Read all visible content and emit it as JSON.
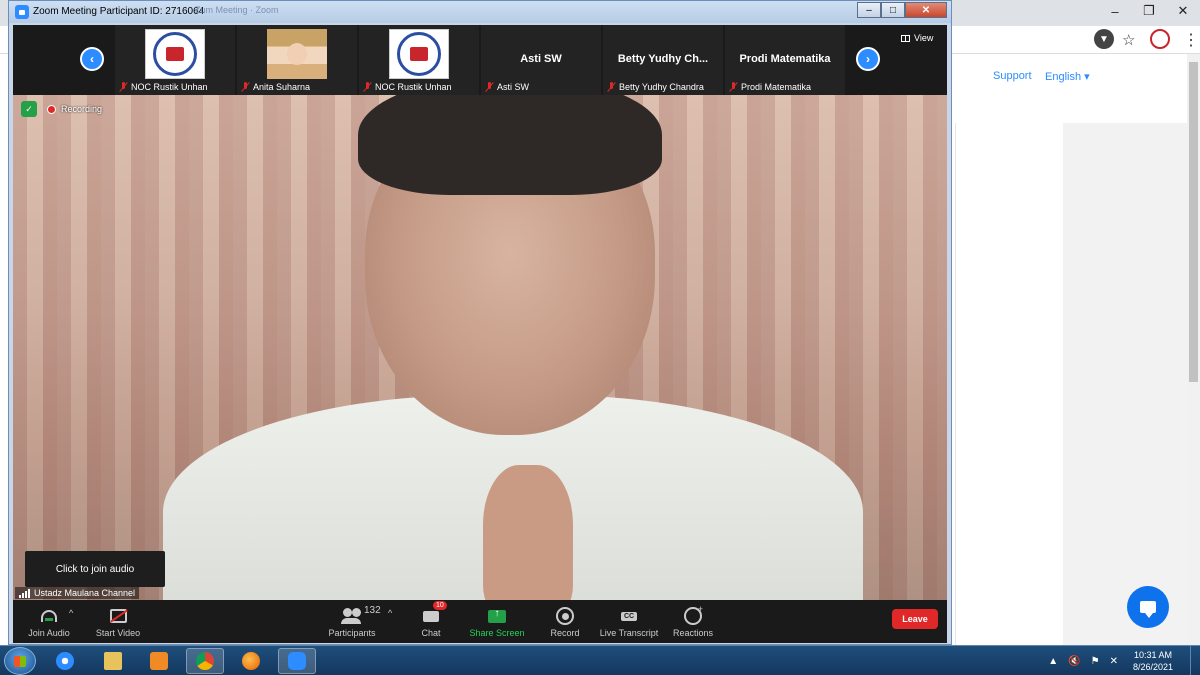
{
  "zoom_window": {
    "title": "Zoom Meeting Participant ID: 2716064",
    "ghost_title": "Zum Meeting · Zoom",
    "controls": {
      "minimize": "–",
      "maximize": "□",
      "close": "✕"
    }
  },
  "participants_strip": {
    "view_label": "View",
    "tiles": [
      {
        "name": "",
        "caption": "NOC Rustik Unhan",
        "type": "logo"
      },
      {
        "name": "",
        "caption": "Anita Suharna",
        "type": "photo"
      },
      {
        "name": "",
        "caption": "NOC Rustik Unhan",
        "type": "logo"
      },
      {
        "name": "Asti SW",
        "caption": "Asti SW",
        "type": "name"
      },
      {
        "name": "Betty Yudhy Ch...",
        "caption": "Betty Yudhy Chandra",
        "type": "name"
      },
      {
        "name": "Prodi Matematika",
        "caption": "Prodi Matematika",
        "type": "name"
      }
    ],
    "prev_arrow": "‹",
    "next_arrow": "›"
  },
  "video": {
    "recording_label": "Recording",
    "join_audio_tip": "Click to join audio",
    "speaker_name": "Ustadz Maulana Channel"
  },
  "toolbar": {
    "join_audio": "Join Audio",
    "start_video": "Start Video",
    "participants": "Participants",
    "participant_count": "132",
    "chat": "Chat",
    "chat_badge": "10",
    "share_screen": "Share Screen",
    "record": "Record",
    "live_transcript": "Live Transcript",
    "reactions": "Reactions",
    "leave": "Leave",
    "caret": "^"
  },
  "browser": {
    "nav_support": "Support",
    "nav_english": "English ▾",
    "star": "☆",
    "menu": "⋮",
    "download": "▼",
    "controls": {
      "minimize": "–",
      "maximize": "❐",
      "close": "✕"
    }
  },
  "taskbar": {
    "time": "10:31 AM",
    "date": "8/26/2021",
    "tray_icons": [
      "▲",
      "🔇",
      "⚑",
      "✕"
    ]
  },
  "colors": {
    "zoom_blue": "#2d8cff",
    "leave_red": "#e02828",
    "share_green": "#24a148"
  }
}
